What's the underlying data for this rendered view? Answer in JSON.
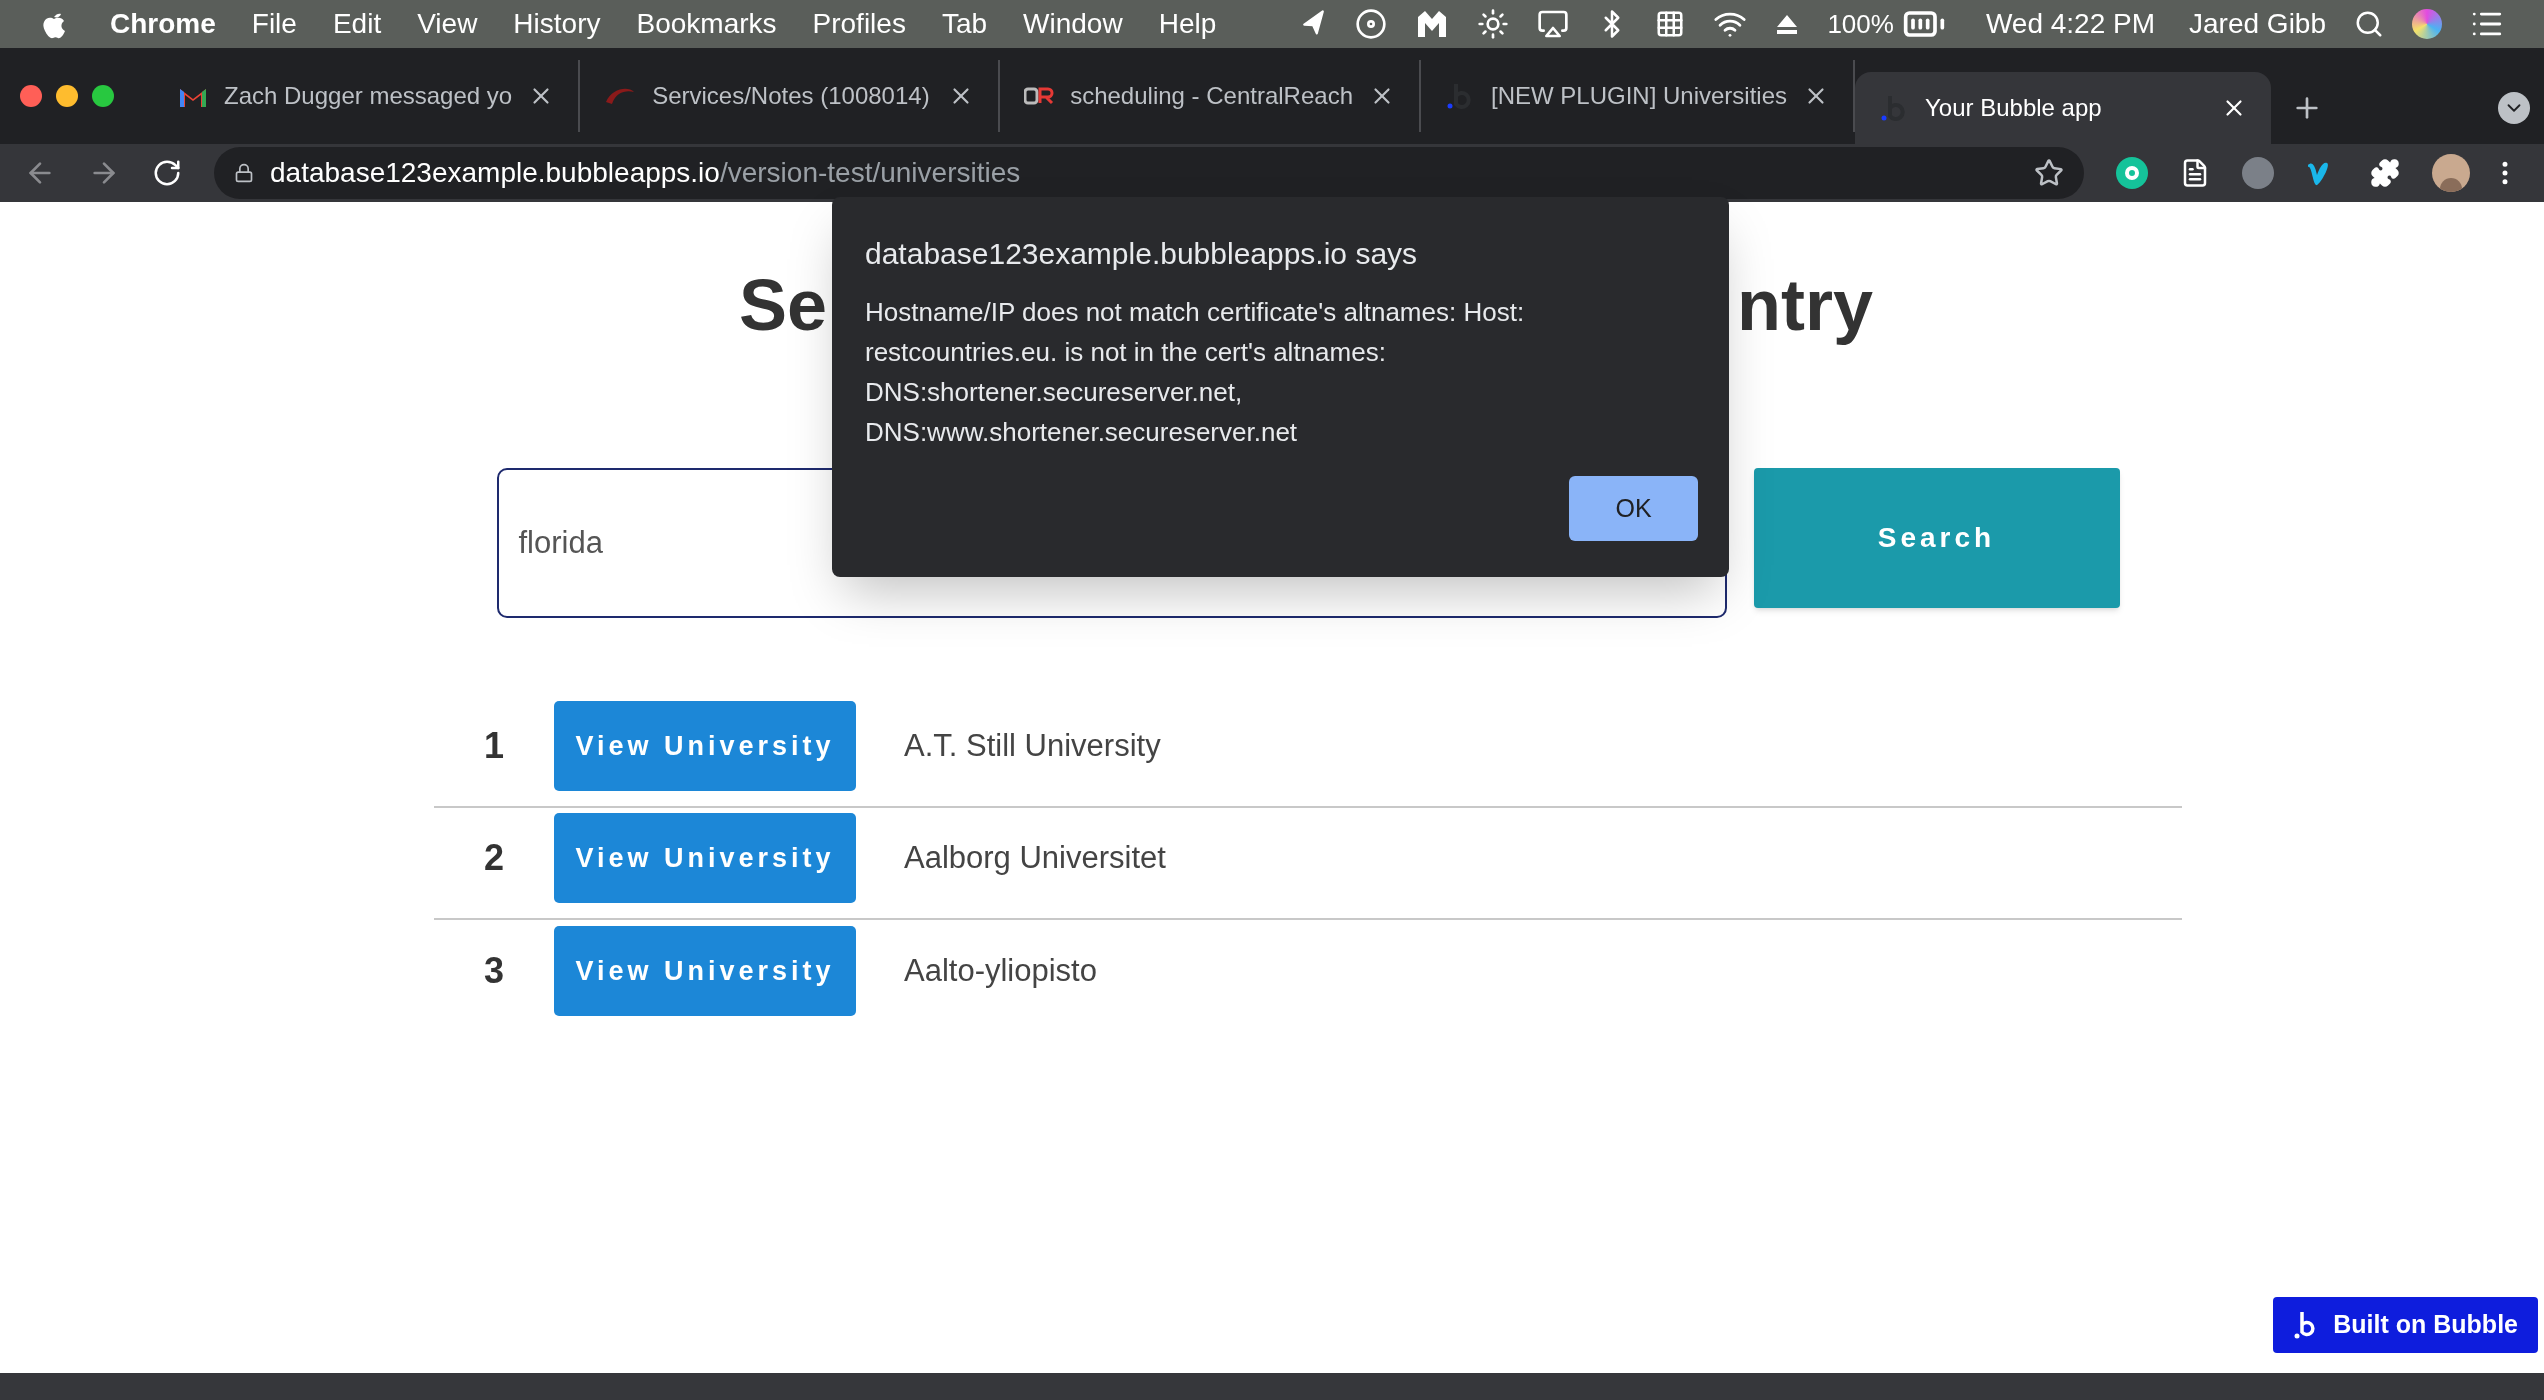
{
  "menubar": {
    "app": "Chrome",
    "menus": [
      "File",
      "Edit",
      "View",
      "History",
      "Bookmarks",
      "Profiles",
      "Tab",
      "Window",
      "Help"
    ],
    "battery": "100%",
    "clock": "Wed 4:22 PM",
    "user": "Jared Gibb"
  },
  "tabs": [
    {
      "title": "Zach Dugger messaged yo",
      "kind": "gmail",
      "selected": false
    },
    {
      "title": "Services/Notes (1008014)",
      "kind": "swoosh",
      "selected": false
    },
    {
      "title": "scheduling - CentralReach",
      "kind": "cr",
      "selected": false
    },
    {
      "title": "[NEW PLUGIN] Universities",
      "kind": "bubble",
      "selected": false
    },
    {
      "title": "Your Bubble app",
      "kind": "bubble",
      "selected": true
    }
  ],
  "address": {
    "host": "database123example.bubbleapps.io",
    "path": "/version-test/universities"
  },
  "page": {
    "heading_left": "Se",
    "heading_right": "ntry",
    "search_value": "florida",
    "search_button": "Search",
    "rows": [
      {
        "number": "1",
        "button": "View University",
        "name": "A.T. Still University"
      },
      {
        "number": "2",
        "button": "View University",
        "name": "Aalborg Universitet"
      },
      {
        "number": "3",
        "button": "View University",
        "name": "Aalto-yliopisto"
      }
    ]
  },
  "dialog": {
    "title": "database123example.bubbleapps.io says",
    "lines": [
      "Hostname/IP does not match certificate's altnames: Host:",
      "restcountries.eu. is not in the cert's altnames:",
      "DNS:shortener.secureserver.net,",
      "DNS:www.shortener.secureserver.net"
    ],
    "ok": "OK"
  },
  "badge": "Built on Bubble"
}
